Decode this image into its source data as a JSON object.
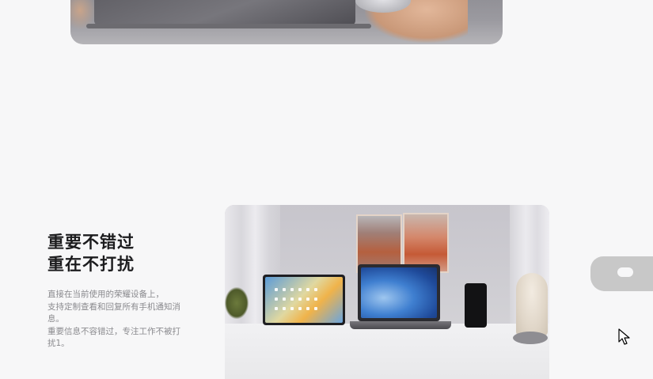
{
  "feature": {
    "title_line1": "重要不错过",
    "title_line2": "重在不打扰",
    "description_lines": [
      "直接在当前使用的荣耀设备上，",
      "支持定制查看和回复所有手机通知消",
      "息。",
      "重要信息不容错过，专注工作不被打",
      "扰1。"
    ]
  },
  "images": {
    "top_photo": "laptop-with-mouse-photo",
    "scene_photo": "multi-device-desk-photo"
  },
  "icons": {
    "cursor": "mouse-pointer-icon"
  }
}
